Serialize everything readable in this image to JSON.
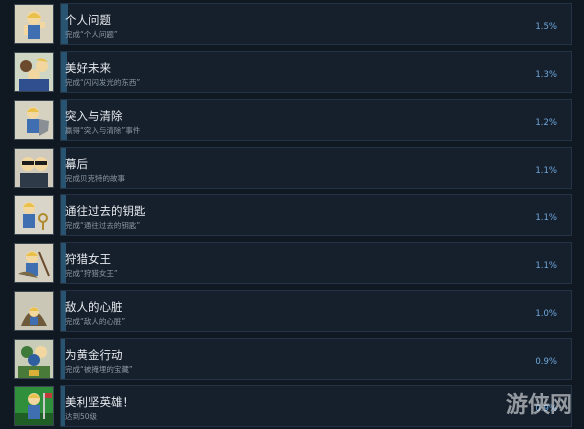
{
  "achievements": [
    {
      "title": "个人问题",
      "desc": "完成“个人问题”",
      "percent": "1.5%",
      "icon": "vault-boy-fist-icon",
      "fill": 0.015
    },
    {
      "title": "美好未来",
      "desc": "完成“闪闪发光的东西”",
      "percent": "1.3%",
      "icon": "vault-boy-group-icon",
      "fill": 0.013
    },
    {
      "title": "突入与清除",
      "desc": "赢得“突入与清除”事件",
      "percent": "1.2%",
      "icon": "vault-boy-shield-icon",
      "fill": 0.012
    },
    {
      "title": "幕后",
      "desc": "完成贝克特的故事",
      "percent": "1.1%",
      "icon": "vault-boy-sunglasses-icon",
      "fill": 0.011
    },
    {
      "title": "通往过去的钥匙",
      "desc": "完成“通往过去的钥匙”",
      "percent": "1.1%",
      "icon": "vault-boy-key-icon",
      "fill": 0.011
    },
    {
      "title": "狩猎女王",
      "desc": "完成“狩猎女王”",
      "percent": "1.1%",
      "icon": "vault-boy-hunter-icon",
      "fill": 0.011
    },
    {
      "title": "敌人的心脏",
      "desc": "完成“敌人的心脏”",
      "percent": "1.0%",
      "icon": "vault-boy-heart-icon",
      "fill": 0.01
    },
    {
      "title": "为黄金行动",
      "desc": "完成“被掩埋的宝藏”",
      "percent": "0.9%",
      "icon": "vault-boy-gold-icon",
      "fill": 0.009
    },
    {
      "title": "美利坚英雄！",
      "desc": "达到50级",
      "percent": "0.9%",
      "icon": "vault-boy-flag-icon",
      "fill": 0.009
    }
  ],
  "watermark": "游侠网",
  "colors": {
    "background": "#101822",
    "bar": "#16202d",
    "fill": "#2a5a7a",
    "percent": "#6fa8dc"
  }
}
